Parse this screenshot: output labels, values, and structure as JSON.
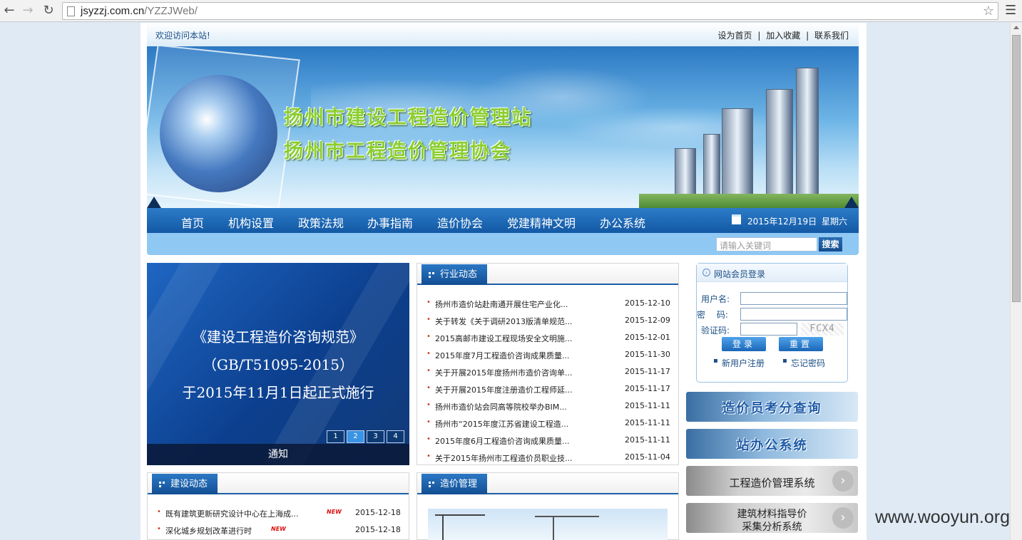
{
  "browser": {
    "url_host": "jsyzzj.com.cn",
    "url_path": "/YZZJWeb/"
  },
  "topbar": {
    "welcome": "欢迎访问本站!",
    "links": [
      "设为首页",
      "加入收藏",
      "联系我们"
    ],
    "separator": "|"
  },
  "banner": {
    "title1": "扬州市建设工程造价管理站",
    "title2": "扬州市工程造价管理协会"
  },
  "nav": {
    "items": [
      "首页",
      "机构设置",
      "政策法规",
      "办事指南",
      "造价协会",
      "党建精神文明",
      "办公系统"
    ],
    "date": "2015年12月19日",
    "weekday": "星期六"
  },
  "search": {
    "placeholder": "请输入关键词",
    "button": "搜索"
  },
  "slideshow": {
    "lines": [
      "《建设工程造价咨询规范》",
      "（GB/T51095-2015）",
      "于2015年11月1日起正式施行"
    ],
    "pages": [
      "1",
      "2",
      "3",
      "4"
    ],
    "active_page": "2",
    "caption": "通知"
  },
  "industry": {
    "title": "行业动态",
    "items": [
      {
        "title": "扬州市造价站赴南通开展住宅产业化...",
        "date": "2015-12-10"
      },
      {
        "title": "关于转发《关于调研2013版清单规范...",
        "date": "2015-12-09"
      },
      {
        "title": "2015高邮市建设工程现场安全文明施...",
        "date": "2015-12-01"
      },
      {
        "title": "2015年度7月工程造价咨询成果质量...",
        "date": "2015-11-30"
      },
      {
        "title": "关于开展2015年度扬州市造价咨询单...",
        "date": "2015-11-17"
      },
      {
        "title": "关于开展2015年度注册造价工程师延...",
        "date": "2015-11-17"
      },
      {
        "title": "扬州市造价站会同高等院校举办BIM...",
        "date": "2015-11-11"
      },
      {
        "title": "扬州市“2015年度江苏省建设工程造...",
        "date": "2015-11-11"
      },
      {
        "title": "2015年度6月工程造价咨询成果质量...",
        "date": "2015-11-11"
      },
      {
        "title": "关于2015年扬州市工程造价员职业技...",
        "date": "2015-11-04"
      }
    ]
  },
  "construction": {
    "title": "建设动态",
    "items": [
      {
        "title": "既有建筑更新研究设计中心在上海成...",
        "date": "2015-12-18",
        "badge": "NEW"
      },
      {
        "title": "深化城乡规划改革进行时",
        "date": "2015-12-18",
        "badge": "NEW"
      }
    ]
  },
  "cost_mgmt": {
    "title": "造价管理"
  },
  "login": {
    "title": "网站会员登录",
    "username_label": "用户名:",
    "password_label": "密　 码:",
    "captcha_label": "验证码:",
    "captcha_text": "FCX4",
    "login_button": "登录",
    "reset_button": "重置",
    "register_link": "新用户注册",
    "forgot_link": "忘记密码"
  },
  "side_buttons": [
    {
      "label": "造价员考分查询"
    },
    {
      "label": "站办公系统"
    },
    {
      "label": "工程造价管理系统"
    },
    {
      "label": "建筑材料指导价\n采集分析系统",
      "line1": "建筑材料指导价",
      "line2": "采集分析系统"
    }
  ],
  "watermark": "www.wooyun.org"
}
